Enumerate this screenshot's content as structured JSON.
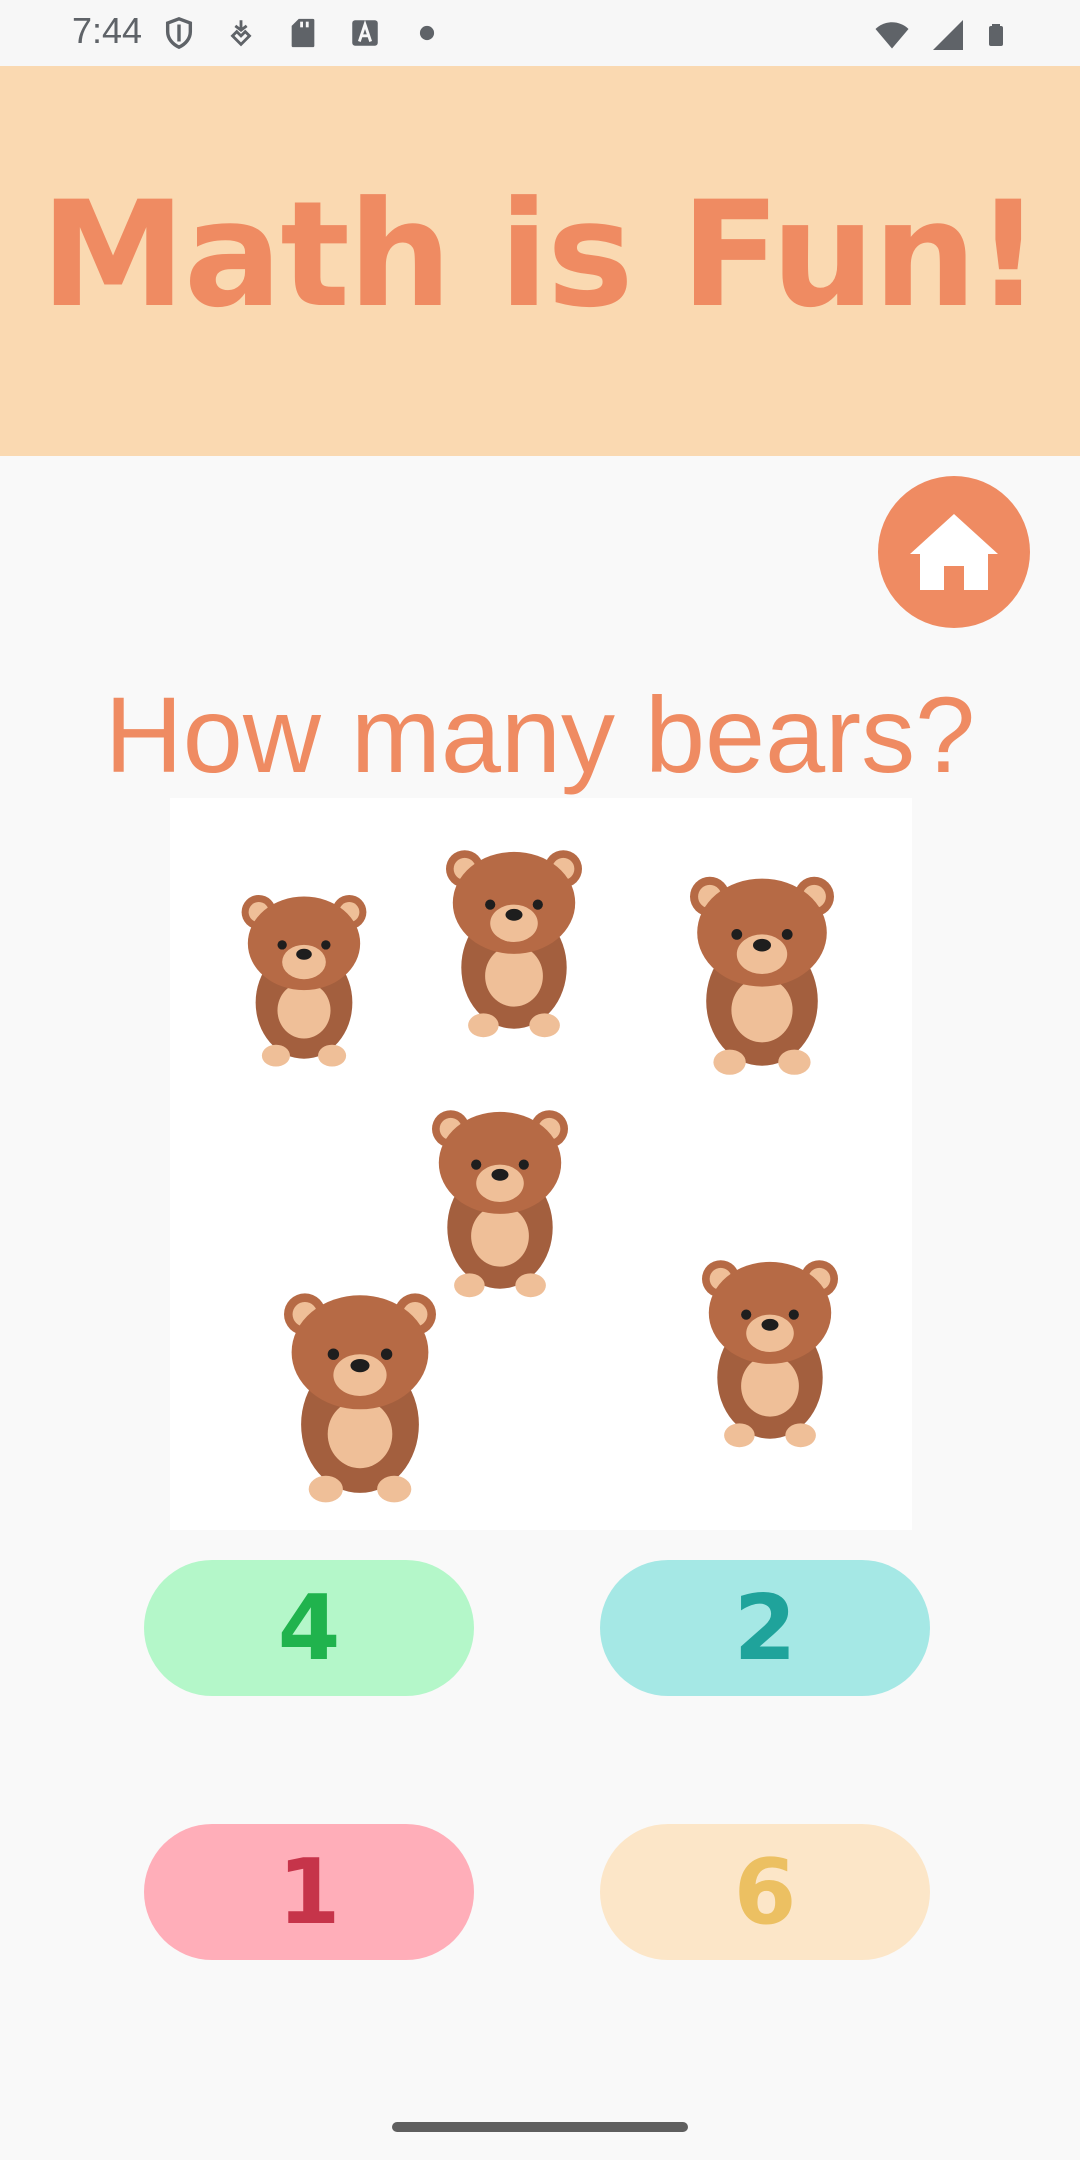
{
  "status_bar": {
    "time": "7:44",
    "left_icons": [
      "shield-icon",
      "location-pin-icon",
      "sd-card-icon",
      "font-a-icon",
      "dot-icon"
    ],
    "right_icons": [
      "wifi-icon",
      "signal-icon",
      "battery-icon"
    ]
  },
  "header": {
    "title": "Math is Fun!",
    "background_color": "#fad9b1",
    "title_color": "#ef8b62"
  },
  "home_button": {
    "icon": "home-icon",
    "color": "#ef8b62"
  },
  "question": {
    "text": "How many bears?",
    "image": "bears-illustration",
    "bear_count_shown": 6
  },
  "answers": [
    {
      "label": "4",
      "bg": "#b4f7c9",
      "fg": "#20b34d"
    },
    {
      "label": "2",
      "bg": "#a5e8e5",
      "fg": "#1fa39b"
    },
    {
      "label": "1",
      "bg": "#ffaeb9",
      "fg": "#c6344a"
    },
    {
      "label": "6",
      "bg": "#fce6c8",
      "fg": "#ecc062"
    }
  ]
}
